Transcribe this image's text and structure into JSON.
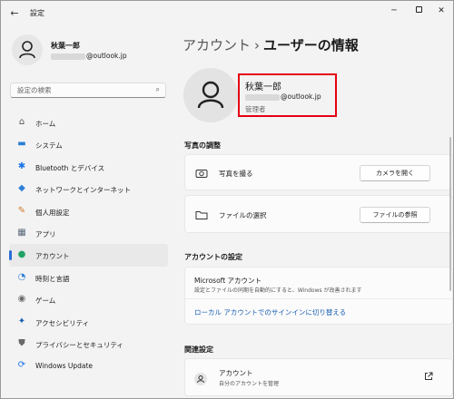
{
  "window": {
    "title": "設定",
    "back_icon": "←",
    "minimize_icon": "─",
    "close_icon": "✕"
  },
  "profile": {
    "name": "秋葉一郎",
    "email_suffix": "@outlook.jp"
  },
  "search": {
    "placeholder": "設定の検索",
    "icon": "⌕"
  },
  "nav": {
    "items": [
      {
        "label": "ホーム",
        "icon": "home-icon",
        "glyph": "⌂",
        "color": "#555555"
      },
      {
        "label": "システム",
        "icon": "system-icon",
        "glyph": "▬",
        "color": "#2a7fd4"
      },
      {
        "label": "Bluetooth とデバイス",
        "icon": "bluetooth-icon",
        "glyph": "✱",
        "color": "#1a73e8"
      },
      {
        "label": "ネットワークとインターネット",
        "icon": "network-icon",
        "glyph": "◆",
        "color": "#2f7fd8"
      },
      {
        "label": "個人用設定",
        "icon": "personalization-icon",
        "glyph": "✎",
        "color": "#d07a2a"
      },
      {
        "label": "アプリ",
        "icon": "apps-icon",
        "glyph": "▦",
        "color": "#5a6a7a"
      },
      {
        "label": "アカウント",
        "icon": "accounts-icon",
        "glyph": "●",
        "color": "#21a366"
      },
      {
        "label": "時刻と言語",
        "icon": "time-language-icon",
        "glyph": "◔",
        "color": "#2a7fd4"
      },
      {
        "label": "ゲーム",
        "icon": "gaming-icon",
        "glyph": "◉",
        "color": "#6b6b6b"
      },
      {
        "label": "アクセシビリティ",
        "icon": "accessibility-icon",
        "glyph": "✦",
        "color": "#1a5fb4"
      },
      {
        "label": "プライバシーとセキュリティ",
        "icon": "privacy-shield-icon",
        "glyph": "⛊",
        "color": "#6a6a6a"
      },
      {
        "label": "Windows Update",
        "icon": "windows-update-icon",
        "glyph": "⟳",
        "color": "#1a73e8"
      }
    ],
    "active_index": 6
  },
  "header": {
    "crumb_parent": "アカウント",
    "separator": "›",
    "crumb_current": "ユーザーの情報"
  },
  "user": {
    "name": "秋葉一郎",
    "email_suffix": "@outlook.jp",
    "role": "管理者",
    "highlight_color": "#e60012"
  },
  "photo": {
    "section_title": "写真の調整",
    "camera_label": "写真を撮る",
    "camera_button": "カメラを開く",
    "file_label": "ファイルの選択",
    "file_button": "ファイルの参照"
  },
  "account_settings": {
    "section_title": "アカウントの設定",
    "ms_title": "Microsoft アカウント",
    "ms_desc": "設定とファイルの同期を自動的にすると、Windows が改善されます",
    "ms_link": "ローカル アカウントでのサインインに切り替える",
    "link_color": "#1a5fb4"
  },
  "related": {
    "section_title": "関連設定",
    "item_title": "アカウント",
    "item_desc": "自分のアカウントを管理"
  },
  "colors": {
    "accent": "#2a6ed6"
  }
}
